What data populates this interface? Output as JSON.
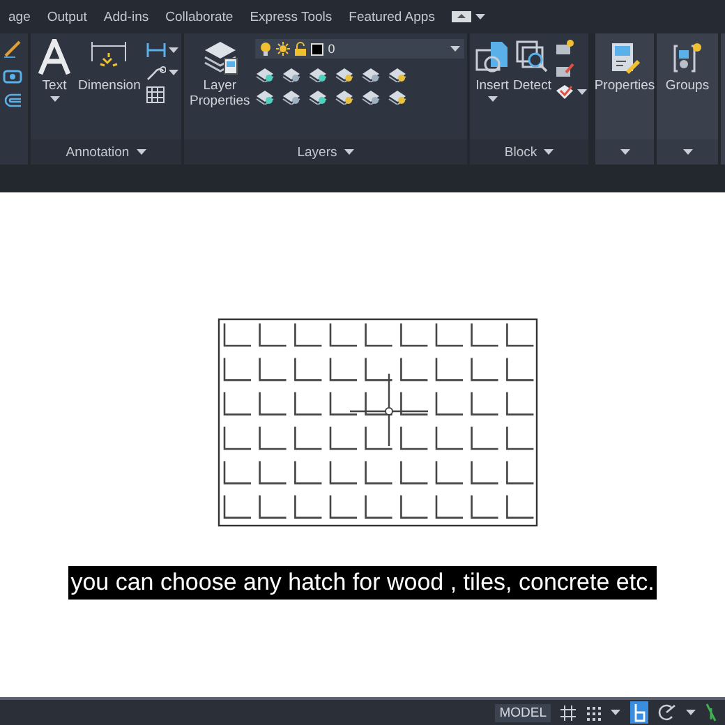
{
  "tabs": [
    "age",
    "Output",
    "Add-ins",
    "Collaborate",
    "Express Tools",
    "Featured Apps"
  ],
  "annotation": {
    "buttons": [
      "Text",
      "Dimension"
    ],
    "title": "Annotation"
  },
  "layers": {
    "button": "Layer Properties",
    "current_layer": "0",
    "title": "Layers"
  },
  "block": {
    "buttons": [
      "Insert",
      "Detect"
    ],
    "title": "Block"
  },
  "properties": {
    "label": "Properties"
  },
  "groups": {
    "label": "Groups"
  },
  "canvas": {
    "subtitle": "you can choose any hatch for wood , tiles, concrete etc."
  },
  "status_bar": {
    "mode": "MODEL"
  }
}
